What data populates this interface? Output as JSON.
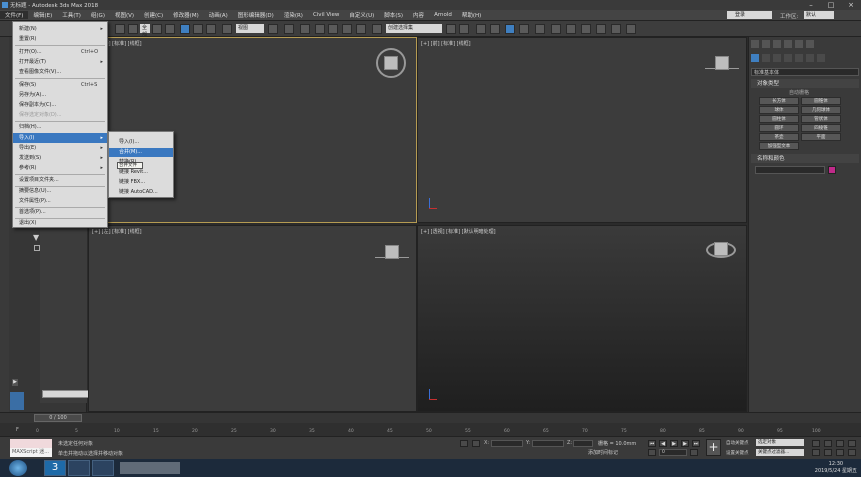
{
  "window": {
    "title": "无标题 - Autodesk 3ds Max 2018",
    "controls": [
      "–",
      "□",
      "×"
    ]
  },
  "menubar": {
    "items": [
      "文件(F)",
      "编辑(E)",
      "工具(T)",
      "组(G)",
      "视图(V)",
      "创建(C)",
      "修改器(M)",
      "动画(A)",
      "图形编辑器(D)",
      "渲染(R)",
      "Civil View",
      "自定义(U)",
      "脚本(S)",
      "内容",
      "Arnold",
      "帮助(H)"
    ],
    "signin": "登录",
    "workspace_label": "工作区:",
    "workspace_value": "默认"
  },
  "toolbar": {
    "filter_value": "全部",
    "view_value": "视图",
    "selection_set": "创建选择集"
  },
  "file_menu": {
    "items": [
      {
        "label": "新建(N)",
        "shortcut": "",
        "arrow": true,
        "disabled": false
      },
      {
        "label": "重置(R)",
        "shortcut": "",
        "arrow": false,
        "disabled": false
      },
      {
        "label": "打开(O)...",
        "shortcut": "Ctrl+O",
        "arrow": false,
        "disabled": false
      },
      {
        "label": "打开最近(T)",
        "shortcut": "",
        "arrow": true,
        "disabled": false
      },
      {
        "label": "查看图像文件(V)...",
        "shortcut": "",
        "arrow": false,
        "disabled": false
      },
      {
        "label": "保存(S)",
        "shortcut": "Ctrl+S",
        "arrow": false,
        "disabled": false
      },
      {
        "label": "另存为(A)...",
        "shortcut": "",
        "arrow": false,
        "disabled": false
      },
      {
        "label": "保存副本为(C)...",
        "shortcut": "",
        "arrow": false,
        "disabled": false
      },
      {
        "label": "保存选定对象(D)...",
        "shortcut": "",
        "arrow": false,
        "disabled": true
      },
      {
        "label": "归档(H)...",
        "shortcut": "",
        "arrow": false,
        "disabled": false
      },
      {
        "label": "导入(I)",
        "shortcut": "",
        "arrow": true,
        "disabled": false,
        "highlight": true
      },
      {
        "label": "导出(E)",
        "shortcut": "",
        "arrow": true,
        "disabled": false
      },
      {
        "label": "发送到(S)",
        "shortcut": "",
        "arrow": true,
        "disabled": false
      },
      {
        "label": "参考(R)",
        "shortcut": "",
        "arrow": true,
        "disabled": false
      },
      {
        "label": "设置项目文件夹...",
        "shortcut": "",
        "arrow": false,
        "disabled": false
      },
      {
        "label": "摘要信息(U)...",
        "shortcut": "",
        "arrow": false,
        "disabled": false
      },
      {
        "label": "文件属性(P)...",
        "shortcut": "",
        "arrow": false,
        "disabled": false
      },
      {
        "label": "首选项(P)...",
        "shortcut": "",
        "arrow": false,
        "disabled": false
      },
      {
        "label": "退出(X)",
        "shortcut": "",
        "arrow": false,
        "disabled": false
      }
    ]
  },
  "import_submenu": {
    "items": [
      "导入(I)...",
      "合并(M)...",
      "替换(R)...",
      "链接 Revit...",
      "链接 FBX...",
      "链接 AutoCAD..."
    ],
    "tooltip": "合并文件"
  },
  "viewports": {
    "top": "[+] [顶] [标准] [线框]",
    "front": "[+] [前] [标准] [线框]",
    "left": "[+] [左] [标准] [线框]",
    "perspective": "[+] [透视] [标准] [默认明暗处理]"
  },
  "command_panel": {
    "category": "标准基本体",
    "object_type_header": "对象类型",
    "autogrid": "自动栅格",
    "buttons": [
      "长方体",
      "圆锥体",
      "球体",
      "几何球体",
      "圆柱体",
      "管状体",
      "圆环",
      "四棱锥",
      "茶壶",
      "平面",
      "加强型文本"
    ],
    "name_color_header": "名称和颜色",
    "swatch_color": "#c02a8a"
  },
  "timeline": {
    "slider": "0 / 100",
    "ticks": [
      "0",
      "5",
      "10",
      "15",
      "20",
      "25",
      "30",
      "35",
      "40",
      "45",
      "50",
      "55",
      "60",
      "65",
      "70",
      "75",
      "80",
      "85",
      "90",
      "95",
      "100"
    ]
  },
  "status": {
    "maxscript": "MAXScript 迷...",
    "line1": "未选定任何对象",
    "line2": "单击并拖动以选择并移动对象",
    "x_label": "X:",
    "y_label": "Y:",
    "z_label": "Z:",
    "grid": "栅格 = 10.0mm",
    "add_tag": "添加时间标记",
    "autokey": "自动关键点",
    "set_key": "设置关键点",
    "selected_object": "选定对象",
    "key_filter": "关键点过滤器...",
    "frame": "0"
  },
  "taskbar": {
    "time": "12:30",
    "date": "2019/5/24 星期五"
  }
}
